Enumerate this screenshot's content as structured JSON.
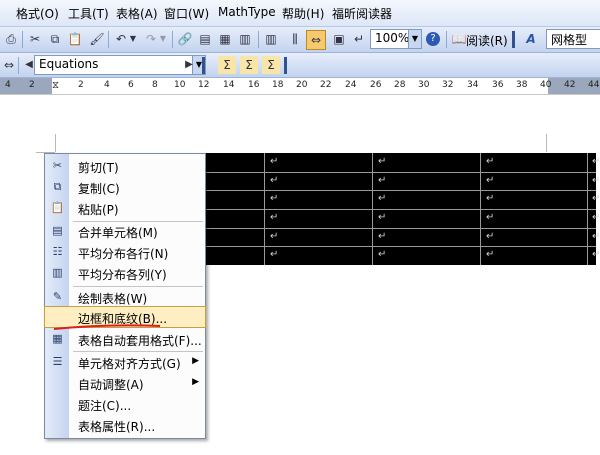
{
  "menubar": {
    "items": [
      "格式(O)",
      "工具(T)",
      "表格(A)",
      "窗口(W)",
      "MathType",
      "帮助(H)",
      "福昕阅读器"
    ]
  },
  "toolbar1": {
    "zoom": "100%",
    "read_label": "阅读(R)",
    "style_sample": "网格型"
  },
  "toolbar2": {
    "style_value": "Equations"
  },
  "ruler": {
    "ticks": [
      "4",
      "2",
      "2",
      "4",
      "6",
      "8",
      "10",
      "12",
      "14",
      "16",
      "18",
      "20",
      "22",
      "24",
      "26",
      "28",
      "30",
      "32",
      "34",
      "36",
      "38",
      "40",
      "42",
      "44"
    ]
  },
  "table": {
    "cell_mark": "↵"
  },
  "context_menu": {
    "items": [
      {
        "label": "剪切(T)",
        "icon": "scissors-icon",
        "submenu": false
      },
      {
        "label": "复制(C)",
        "icon": "copy-icon",
        "submenu": false
      },
      {
        "label": "粘贴(P)",
        "icon": "paste-icon",
        "submenu": false
      },
      {
        "label": "合并单元格(M)",
        "icon": "merge-cells-icon",
        "submenu": false
      },
      {
        "label": "平均分布各行(N)",
        "icon": "distribute-rows-icon",
        "submenu": false
      },
      {
        "label": "平均分布各列(Y)",
        "icon": "distribute-columns-icon",
        "submenu": false
      },
      {
        "label": "绘制表格(W)",
        "icon": "draw-table-icon",
        "submenu": false
      },
      {
        "label": "边框和底纹(B)...",
        "icon": "",
        "submenu": false
      },
      {
        "label": "表格自动套用格式(F)...",
        "icon": "table-autoformat-icon",
        "submenu": false
      },
      {
        "label": "单元格对齐方式(G)",
        "icon": "cell-align-icon",
        "submenu": true
      },
      {
        "label": "自动调整(A)",
        "icon": "",
        "submenu": true
      },
      {
        "label": "题注(C)...",
        "icon": "",
        "submenu": false
      },
      {
        "label": "表格属性(R)...",
        "icon": "",
        "submenu": false
      }
    ],
    "highlighted_index": 7
  },
  "colors": {
    "highlight": "#ffeec2",
    "annotation": "#d9201b",
    "table_fill": "#000000"
  }
}
